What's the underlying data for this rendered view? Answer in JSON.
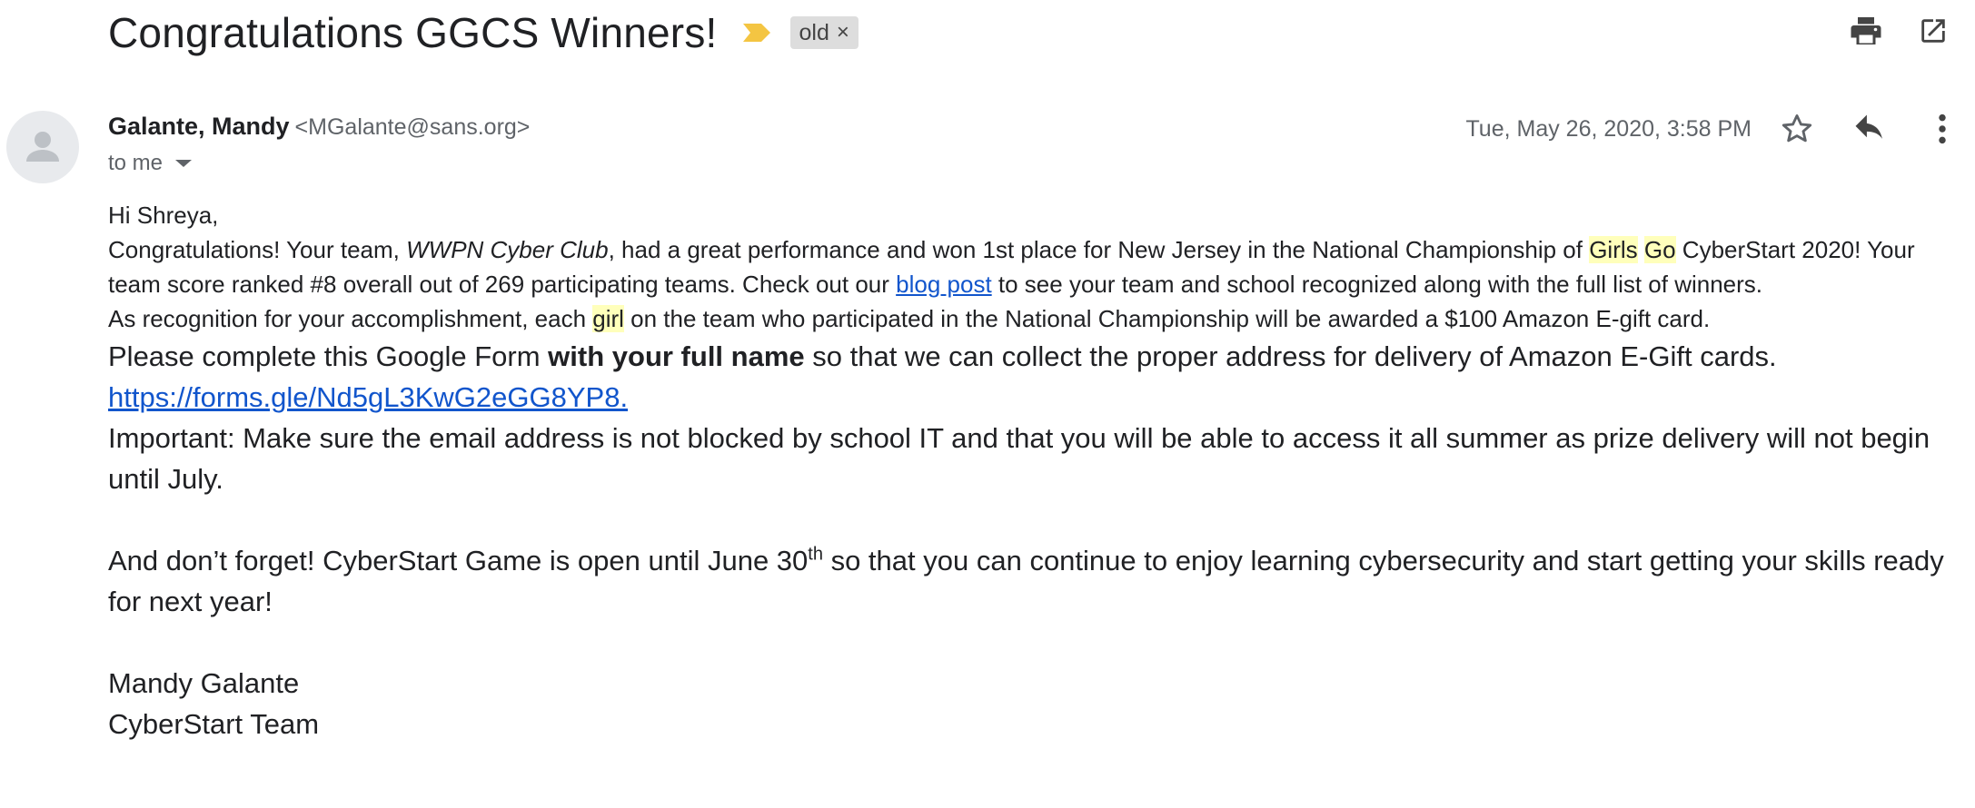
{
  "header": {
    "subject": "Congratulations GGCS Winners!",
    "label": "old",
    "label_remove": "×"
  },
  "sender": {
    "name": "Galante, Mandy",
    "email": "<MGalante@sans.org>",
    "to": "to me",
    "date": "Tue, May 26, 2020, 3:58 PM"
  },
  "icons": {
    "print": "print-icon",
    "popout": "open-in-new-window-icon",
    "star": "star-icon",
    "reply": "reply-icon",
    "more": "more-vert-icon",
    "importance": "importance-marker-icon",
    "avatar": "default-avatar-icon"
  },
  "colors": {
    "link": "#1155cc",
    "highlight": "#ffffbb",
    "importance": "#f4c542"
  },
  "message": {
    "greeting": "Hi Shreya,",
    "p1_a": "Congratulations!  Your team, ",
    "p1_team": "WWPN Cyber Club",
    "p1_b": ", had a great performance and won 1st place for New Jersey in the National Championship of ",
    "p1_hl1": "Girls",
    "p1_hl2": "Go",
    "p1_c": " CyberStart 2020!   Your team score ranked #8  overall out of 269 participating teams.  Check out our ",
    "p1_link": "blog post",
    "p1_d": " to see your team and school recognized along with the full list of winners.",
    "p2_a": "As recognition for your accomplishment, each ",
    "p2_hl": "girl",
    "p2_b": " on the team who participated in the National Championship will be awarded a $100 Amazon E-gift card.",
    "p3_a": "Please complete this Google Form ",
    "p3_bold": "with your full name",
    "p3_b": " so that we can collect the proper address for delivery of Amazon E-Gift cards.  ",
    "p3_link": "https://forms.gle/Nd5gL3KwG2eGG8YP8.  ",
    "p4": "Important: Make sure the email address is not blocked by school IT and that you will be able to access it all summer as prize delivery will not begin until July.",
    "p5_a": "And don’t forget!  CyberStart Game is open until June 30",
    "p5_sup": "th",
    "p5_b": " so that you can continue to enjoy learning cybersecurity and start getting your skills ready for next year!",
    "sig_name": "Mandy Galante",
    "sig_team": "CyberStart Team"
  }
}
